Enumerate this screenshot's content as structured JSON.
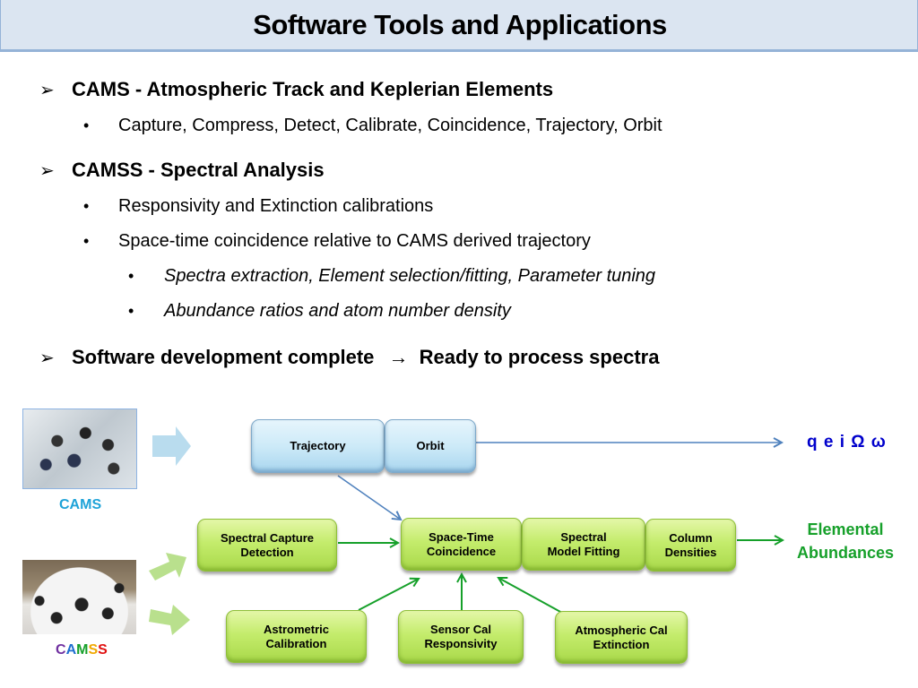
{
  "title": "Software Tools and Applications",
  "bullets": [
    {
      "level": 1,
      "marker": "arrow-bullet",
      "text": "CAMS  -  Atmospheric Track and Keplerian Elements"
    },
    {
      "level": 2,
      "marker": "dot-bullet",
      "text": "Capture,  Compress,  Detect,  Calibrate,  Coincidence,  Trajectory,  Orbit"
    },
    {
      "level": 1,
      "marker": "arrow-bullet",
      "text": "CAMSS  -  Spectral Analysis"
    },
    {
      "level": 2,
      "marker": "dot-bullet",
      "text": "Responsivity and Extinction calibrations"
    },
    {
      "level": 2,
      "marker": "dot-bullet",
      "text": "Space-time coincidence relative to CAMS derived trajectory"
    },
    {
      "level": 3,
      "marker": "dot-bullet",
      "text": "Spectra extraction, Element selection/fitting, Parameter tuning"
    },
    {
      "level": 3,
      "marker": "dot-bullet",
      "text": "Abundance ratios and atom number density"
    }
  ],
  "conclusion": {
    "left": "Software development complete",
    "arrow": "→",
    "right": "Ready to process spectra"
  },
  "markers": {
    "arrow": "➢",
    "dot": "•"
  },
  "photos": {
    "cams_caption": "CAMS",
    "camss_caption_letters": [
      {
        "ch": "C",
        "color": "#7030a0"
      },
      {
        "ch": "A",
        "color": "#1f6fd0"
      },
      {
        "ch": "M",
        "color": "#16a02a"
      },
      {
        "ch": "S",
        "color": "#f0a800"
      },
      {
        "ch": "S",
        "color": "#e01010"
      }
    ]
  },
  "diagram": {
    "blue_boxes": [
      {
        "id": "trajectory",
        "label": [
          "Trajectory"
        ]
      },
      {
        "id": "orbit",
        "label": [
          "Orbit"
        ]
      }
    ],
    "green_boxes": [
      {
        "id": "spectral-capture",
        "label": [
          "Spectral Capture",
          "Detection"
        ]
      },
      {
        "id": "space-time",
        "label": [
          "Space-Time",
          "Coincidence"
        ]
      },
      {
        "id": "spectral-model",
        "label": [
          "Spectral",
          "Model Fitting"
        ]
      },
      {
        "id": "column-densities",
        "label": [
          "Column",
          "Densities"
        ]
      },
      {
        "id": "astrometric",
        "label": [
          "Astrometric",
          "Calibration"
        ]
      },
      {
        "id": "sensor-cal",
        "label": [
          "Sensor Cal",
          "Responsivity"
        ]
      },
      {
        "id": "atmospheric-cal",
        "label": [
          "Atmospheric Cal",
          "Extinction"
        ]
      }
    ],
    "orbit_output": "q e i Ω ω",
    "abundance_output": [
      "Elemental",
      "Abundances"
    ]
  },
  "colors": {
    "title_bg": "#dbe5f1",
    "blue_arrow": "#4f81bd",
    "green_arrow": "#16a02a",
    "cams_caption": "#1fa3d8",
    "orbit_output": "#0000cc",
    "abundance_output": "#16a02a"
  }
}
